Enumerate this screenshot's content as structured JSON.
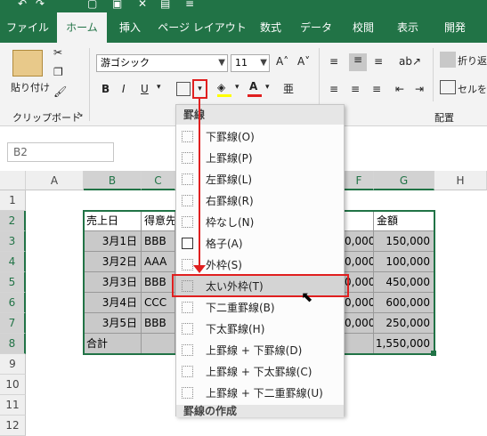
{
  "ribbon_tabs": [
    "ファイル",
    "ホーム",
    "挿入",
    "ページ レイアウト",
    "数式",
    "データ",
    "校閲",
    "表示",
    "開発"
  ],
  "active_tab": "ホーム",
  "clipboard": {
    "paste_label": "貼り付け",
    "group_label": "クリップボード"
  },
  "font": {
    "name": "游ゴシック",
    "size": "11",
    "bold": "B",
    "italic": "I",
    "underline": "U"
  },
  "alignment": {
    "wrap_label": "折り返",
    "merge_label": "セルを結",
    "group_label": "配置"
  },
  "name_box": "B2",
  "columns": [
    "A",
    "B",
    "C",
    "F",
    "G",
    "H"
  ],
  "rows": [
    "1",
    "2",
    "3",
    "4",
    "5",
    "6",
    "7",
    "8",
    "9",
    "10",
    "11",
    "12"
  ],
  "table": {
    "header": {
      "date": "売上日",
      "customer": "得意先",
      "amount": "金額"
    },
    "rows": [
      {
        "date": "3月1日",
        "customer": "BBB",
        "f": "0,000",
        "amount": "150,000"
      },
      {
        "date": "3月2日",
        "customer": "AAA",
        "f": "0,000",
        "amount": "100,000"
      },
      {
        "date": "3月3日",
        "customer": "BBB",
        "f": "0,000",
        "amount": "450,000"
      },
      {
        "date": "3月4日",
        "customer": "CCC",
        "f": "0,000",
        "amount": "600,000"
      },
      {
        "date": "3月5日",
        "customer": "BBB",
        "f": "0,000",
        "amount": "250,000"
      }
    ],
    "total_label": "合計",
    "total_amount": "1,550,000"
  },
  "border_menu": {
    "header": "罫線",
    "items": [
      "下罫線(O)",
      "上罫線(P)",
      "左罫線(L)",
      "右罫線(R)",
      "枠なし(N)",
      "格子(A)",
      "外枠(S)",
      "太い外枠(T)",
      "下二重罫線(B)",
      "下太罫線(H)",
      "上罫線 + 下罫線(D)",
      "上罫線 + 下太罫線(C)",
      "上罫線 + 下二重罫線(U)"
    ],
    "highlighted_index": 7,
    "footer": "罫線の作成"
  },
  "colors": {
    "excel_green": "#217346",
    "highlight_red": "#e01f1f",
    "selected_gray": "#c9c9c9"
  }
}
